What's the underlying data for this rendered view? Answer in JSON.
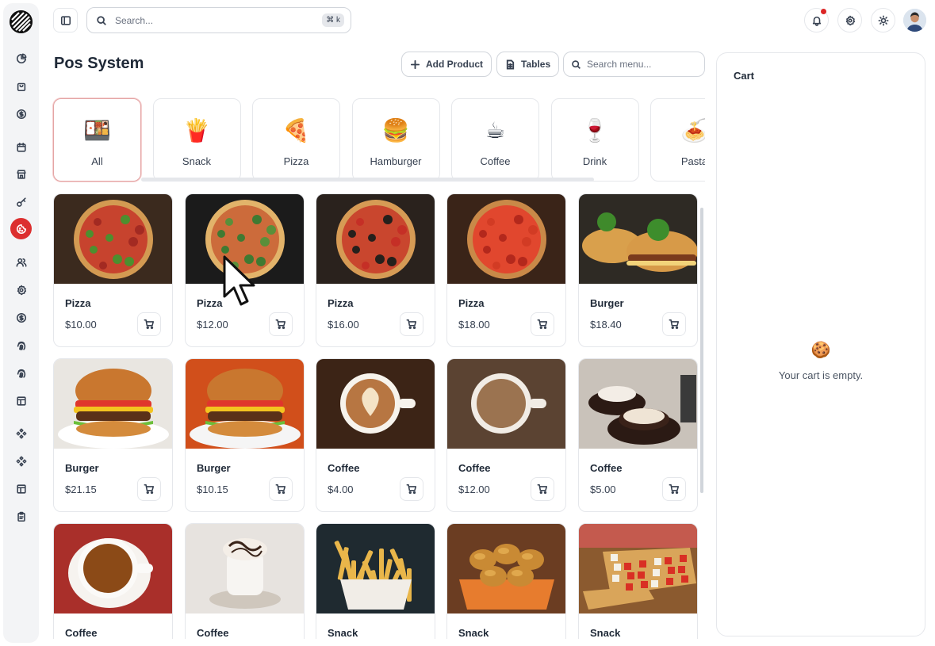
{
  "header": {
    "search_placeholder": "Search...",
    "search_shortcut": "⌘ k",
    "page_title": "Pos System",
    "add_product_label": "Add Product",
    "tables_label": "Tables",
    "menu_search_placeholder": "Search menu..."
  },
  "sidebar": {
    "items": [
      {
        "icon": "pie-chart-icon"
      },
      {
        "icon": "shopping-bag-icon"
      },
      {
        "icon": "dollar-circle-icon"
      },
      {
        "icon": "calendar-icon"
      },
      {
        "icon": "store-icon"
      },
      {
        "icon": "key-icon"
      },
      {
        "icon": "cookie-icon",
        "active": true
      },
      {
        "icon": "users-icon"
      },
      {
        "icon": "gear-icon"
      },
      {
        "icon": "dollar-circle-icon"
      },
      {
        "icon": "fingerprint-icon"
      },
      {
        "icon": "fingerprint-icon"
      },
      {
        "icon": "layout-icon"
      },
      {
        "icon": "component-icon"
      },
      {
        "icon": "component-icon"
      },
      {
        "icon": "layout-icon"
      },
      {
        "icon": "clipboard-icon"
      }
    ]
  },
  "categories": [
    {
      "label": "All",
      "emoji": "🍱",
      "active": true
    },
    {
      "label": "Snack",
      "emoji": "🍟"
    },
    {
      "label": "Pizza",
      "emoji": "🍕"
    },
    {
      "label": "Hamburger",
      "emoji": "🍔"
    },
    {
      "label": "Coffee",
      "emoji": "☕"
    },
    {
      "label": "Drink",
      "emoji": "🍷"
    },
    {
      "label": "Pasta",
      "emoji": "🍝"
    }
  ],
  "products": [
    {
      "name": "Pizza",
      "price": "$10.00",
      "kind": "pizza"
    },
    {
      "name": "Pizza",
      "price": "$12.00",
      "kind": "pizza-green"
    },
    {
      "name": "Pizza",
      "price": "$16.00",
      "kind": "pizza-olive"
    },
    {
      "name": "Pizza",
      "price": "$18.00",
      "kind": "pizza-pepperoni"
    },
    {
      "name": "Burger",
      "price": "$18.40",
      "kind": "burger-open"
    },
    {
      "name": "Burger",
      "price": "$21.15",
      "kind": "burger"
    },
    {
      "name": "Burger",
      "price": "$10.15",
      "kind": "burger-tall"
    },
    {
      "name": "Coffee",
      "price": "$4.00",
      "kind": "latte"
    },
    {
      "name": "Coffee",
      "price": "$12.00",
      "kind": "coffee-wood"
    },
    {
      "name": "Coffee",
      "price": "$5.00",
      "kind": "coffee-cups"
    },
    {
      "name": "Coffee",
      "price": "",
      "kind": "espresso"
    },
    {
      "name": "Coffee",
      "price": "",
      "kind": "mocha"
    },
    {
      "name": "Snack",
      "price": "",
      "kind": "fries"
    },
    {
      "name": "Snack",
      "price": "",
      "kind": "croquettes"
    },
    {
      "name": "Snack",
      "price": "",
      "kind": "bruschetta"
    }
  ],
  "cart": {
    "title": "Cart",
    "empty_icon": "🍪",
    "empty_text": "Your cart is empty."
  }
}
